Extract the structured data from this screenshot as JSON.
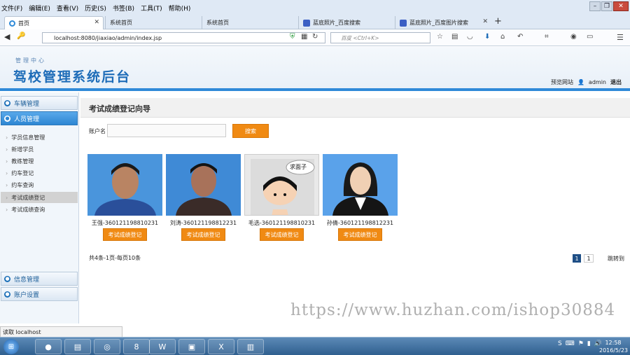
{
  "menu": [
    "文件(F)",
    "编辑(E)",
    "查看(V)",
    "历史(S)",
    "书签(B)",
    "工具(T)",
    "帮助(H)"
  ],
  "tabs": [
    {
      "label": "首页"
    },
    {
      "label": "系统首页"
    },
    {
      "label": "系统首页"
    },
    {
      "label": "蓝底照片_百度搜索"
    },
    {
      "label": "蓝底照片_百度图片搜索"
    }
  ],
  "url": "localhost:8080/jiaxiao/admin/index.jsp",
  "search_placeholder": "百度 <Ctrl+K>",
  "header": {
    "subtitle": "管理中心",
    "title": "驾校管理系统后台",
    "links": {
      "preview": "预览网站",
      "user": "admin",
      "logout": "退出"
    }
  },
  "sidebar": {
    "sections": [
      "车辆管理",
      "人员管理",
      "信息管理",
      "账户设置"
    ],
    "items": [
      "学员信息管理",
      "新增学员",
      "教练管理",
      "约车登记",
      "约车查询",
      "考试成绩登记",
      "考试成绩查询"
    ],
    "selected": "考试成绩登记"
  },
  "main": {
    "title": "考试成绩登记向导",
    "search_label": "账户名",
    "search_value": "",
    "search_button": "搜索",
    "cards": [
      {
        "caption": "王强-360121198810231",
        "button": "考试成绩登记",
        "photo": "blue-bg-male"
      },
      {
        "caption": "刘涛-360121198812231",
        "button": "考试成绩登记",
        "photo": "blue-bg-male"
      },
      {
        "caption": "毛选-360121198810231",
        "button": "考试成绩登记",
        "photo": "cartoon-求面子",
        "photo_text": "求面子"
      },
      {
        "caption": "孙倩-360121198812231",
        "button": "考试成绩登记",
        "photo": "blue-bg-female"
      }
    ],
    "pager_text": "共4条-1页-每页10条",
    "pager_current": "1",
    "pager_page": "1",
    "pager_jump": "跳转到"
  },
  "watermark": "https://www.huzhan.com/ishop30884",
  "status": "读取 localhost",
  "clock": {
    "time": "12:58",
    "date": "2016/5/23"
  },
  "colors": {
    "accent_blue": "#2f8ad8",
    "button_orange": "#f08a13",
    "title_blue": "#1d6cb8"
  }
}
